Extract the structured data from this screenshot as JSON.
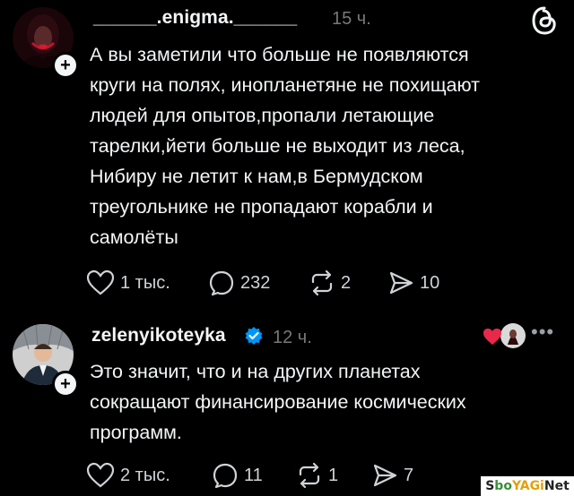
{
  "posts": [
    {
      "username": "______.enigma.______",
      "time": "15 ч.",
      "text": "А вы заметили что больше не появляются\nкруги на полях, инопланетяне не похищают\nлюдей для опытов,пропали летающие\nтарелки,йети больше не выходит из леса,\nНибиру не летит к нам,в Бермудском\nтреугольнике не пропадают корабли и\nсамолёты",
      "likes": "1 тыс.",
      "replies": "232",
      "reposts": "2",
      "shares": "10"
    },
    {
      "username": "zelenyikoteyka",
      "time": "12 ч.",
      "text": "Это значит, что и на других планетах\nсокращают финансирование космических\nпрограмм.",
      "likes": "2 тыс.",
      "replies": "11",
      "reposts": "1",
      "shares": "7"
    }
  ],
  "icons": {
    "app_logo": "threads-logo-icon",
    "like": "heart-icon",
    "reply": "speech-bubble-icon",
    "repost": "repost-icon",
    "share": "send-icon",
    "verified": "verified-badge-icon",
    "more": "more-options-icon"
  },
  "colors": {
    "background": "#000000",
    "text": "#f3f5f7",
    "muted": "#777777",
    "verified": "#0095f6",
    "liked_heart": "#e8294c"
  },
  "watermark": {
    "s": "S",
    "ob": "bo",
    "y": "YAGi",
    "net": "Net"
  }
}
